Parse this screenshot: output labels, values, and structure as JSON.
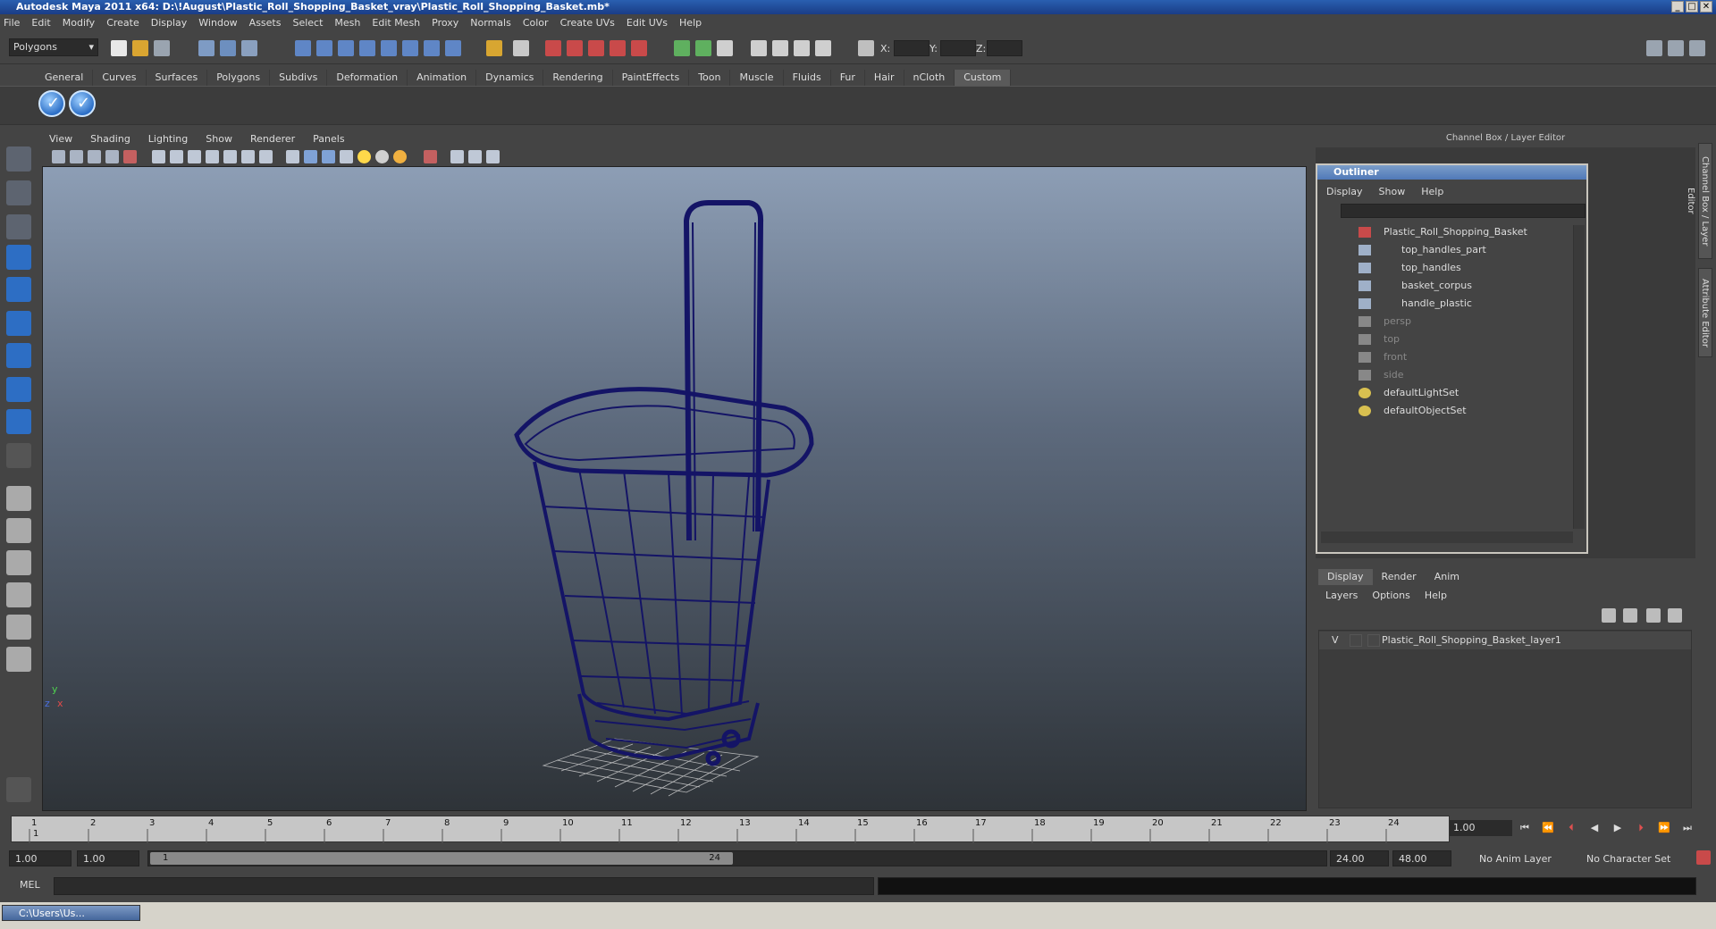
{
  "window": {
    "title": "Autodesk Maya 2011 x64: D:\\!August\\Plastic_Roll_Shopping_Basket_vray\\Plastic_Roll_Shopping_Basket.mb*",
    "controls": [
      "_",
      "□",
      "✕"
    ]
  },
  "menubar": [
    "File",
    "Edit",
    "Modify",
    "Create",
    "Display",
    "Window",
    "Assets",
    "Select",
    "Mesh",
    "Edit Mesh",
    "Proxy",
    "Normals",
    "Color",
    "Create UVs",
    "Edit UVs",
    "Help"
  ],
  "statusline": {
    "menuset": "Polygons",
    "x_label": "X:",
    "y_label": "Y:",
    "z_label": "Z:"
  },
  "shelf": {
    "tabs": [
      "General",
      "Curves",
      "Surfaces",
      "Polygons",
      "Subdivs",
      "Deformation",
      "Animation",
      "Dynamics",
      "Rendering",
      "PaintEffects",
      "Toon",
      "Muscle",
      "Fluids",
      "Fur",
      "Hair",
      "nCloth",
      "Custom"
    ],
    "active_tab": "Custom"
  },
  "panel": {
    "menu": [
      "View",
      "Shading",
      "Lighting",
      "Show",
      "Renderer",
      "Panels"
    ]
  },
  "viewport": {
    "axis_y": "y",
    "axis_x": "x",
    "axis_z": "z",
    "wire_color": "#141466"
  },
  "channelbox": {
    "header": "Channel Box / Layer Editor",
    "vtab_channel": "Channel Box / Layer Editor",
    "vtab_attribute": "Attribute Editor"
  },
  "outliner": {
    "title": "Outliner",
    "menu": [
      "Display",
      "Show",
      "Help"
    ],
    "items": [
      {
        "label": "Plastic_Roll_Shopping_Basket",
        "indent": 0,
        "dim": false,
        "icon": "transform-icon"
      },
      {
        "label": "top_handles_part",
        "indent": 1,
        "dim": false,
        "icon": "mesh-icon"
      },
      {
        "label": "top_handles",
        "indent": 1,
        "dim": false,
        "icon": "mesh-icon"
      },
      {
        "label": "basket_corpus",
        "indent": 1,
        "dim": false,
        "icon": "mesh-icon"
      },
      {
        "label": "handle_plastic",
        "indent": 1,
        "dim": false,
        "icon": "mesh-icon"
      },
      {
        "label": "persp",
        "indent": 0,
        "dim": true,
        "icon": "camera-icon"
      },
      {
        "label": "top",
        "indent": 0,
        "dim": true,
        "icon": "camera-icon"
      },
      {
        "label": "front",
        "indent": 0,
        "dim": true,
        "icon": "camera-icon"
      },
      {
        "label": "side",
        "indent": 0,
        "dim": true,
        "icon": "camera-icon"
      },
      {
        "label": "defaultLightSet",
        "indent": 0,
        "dim": false,
        "icon": "set-icon"
      },
      {
        "label": "defaultObjectSet",
        "indent": 0,
        "dim": false,
        "icon": "set-icon"
      }
    ]
  },
  "layers": {
    "tabs": [
      "Display",
      "Render",
      "Anim"
    ],
    "active_tab": "Display",
    "menu": [
      "Layers",
      "Options",
      "Help"
    ],
    "rows": [
      {
        "visible": "V",
        "name": "Plastic_Roll_Shopping_Basket_layer1"
      }
    ]
  },
  "timeslider": {
    "ticks": [
      "1",
      "2",
      "3",
      "4",
      "5",
      "6",
      "7",
      "8",
      "9",
      "10",
      "11",
      "12",
      "13",
      "14",
      "15",
      "16",
      "17",
      "18",
      "19",
      "20",
      "21",
      "22",
      "23",
      "24"
    ],
    "current_marker": "1",
    "current_frame": "1.00"
  },
  "range": {
    "start": "1.00",
    "start_inner": "1.00",
    "thumb_start": "1",
    "thumb_end": "24",
    "end_inner": "24.00",
    "end": "48.00",
    "anim_layer": "No Anim Layer",
    "character_set": "No Character Set"
  },
  "commandline": {
    "label": "MEL"
  },
  "taskbar": {
    "item": "C:\\Users\\Us..."
  }
}
